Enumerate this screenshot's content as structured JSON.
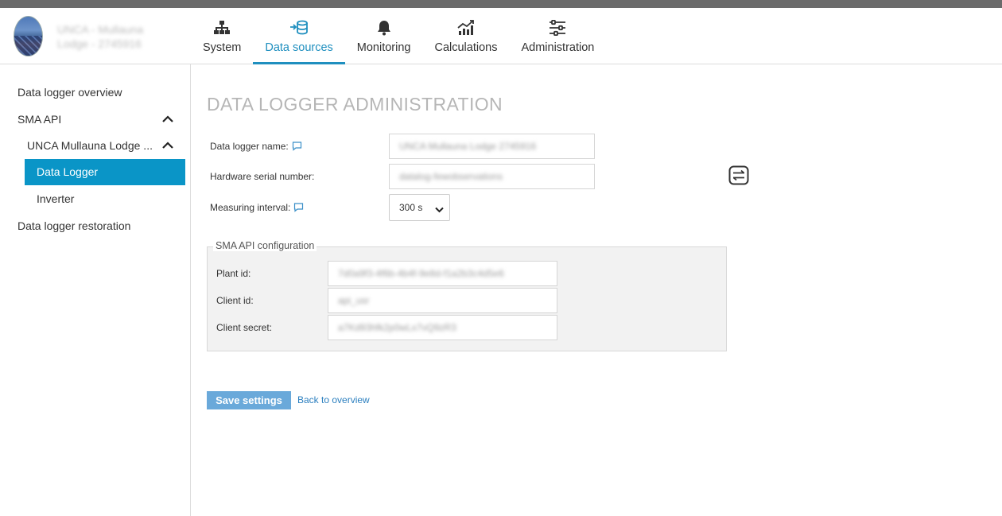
{
  "header": {
    "site_name_line1": "UNCA - Mullauna",
    "site_name_line2": "Lodge - 2745916",
    "nav": [
      {
        "label": "System",
        "icon": "sitemap-icon",
        "active": false
      },
      {
        "label": "Data sources",
        "icon": "database-arrow-icon",
        "active": true
      },
      {
        "label": "Monitoring",
        "icon": "bell-icon",
        "active": false
      },
      {
        "label": "Calculations",
        "icon": "chart-growth-icon",
        "active": false
      },
      {
        "label": "Administration",
        "icon": "sliders-icon",
        "active": false
      }
    ],
    "accent_color": "#1f8fbf"
  },
  "sidebar": {
    "overview": "Data logger overview",
    "api": "SMA API",
    "plant": "UNCA Mullauna Lodge ...",
    "data_logger": "Data Logger",
    "inverter": "Inverter",
    "restoration": "Data logger restoration",
    "active_color": "#0a95c7"
  },
  "main": {
    "title": "DATA LOGGER ADMINISTRATION",
    "fields": {
      "name_label": "Data logger name:",
      "name_value": "UNCA Mullauna Lodge 2745916",
      "serial_label": "Hardware serial number:",
      "serial_value": "datalog-fewobservations",
      "interval_label": "Measuring interval:",
      "interval_value": "300 s"
    },
    "api_config": {
      "legend": "SMA API configuration",
      "plant_label": "Plant id:",
      "plant_value": "7d0a9f3-4f6b-4b4f-9e8d-f1a2b3c4d5e6",
      "client_label": "Client id:",
      "client_value": "api_usr",
      "secret_label": "Client secret:",
      "secret_value": "a7Kd93hfk2p0wLx7vQ9zR3"
    },
    "save_label": "Save settings",
    "back_label": "Back to overview"
  }
}
